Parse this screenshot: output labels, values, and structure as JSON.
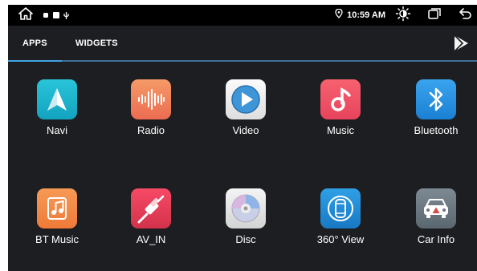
{
  "status_bar": {
    "time": "10:59 AM",
    "icons": [
      "home-icon",
      "status-indicator-icons",
      "location-icon",
      "brightness-icon",
      "recent-apps-icon",
      "back-icon"
    ]
  },
  "tabs": [
    {
      "label": "APPS",
      "active": true
    },
    {
      "label": "WIDGETS",
      "active": false
    }
  ],
  "apps": [
    {
      "label": "Navi",
      "icon": "navigation-arrow-icon",
      "color": "#1aafc9"
    },
    {
      "label": "Radio",
      "icon": "radio-waveform-icon",
      "color": "#f07f5b"
    },
    {
      "label": "Video",
      "icon": "video-play-icon",
      "color": "#3e95d8"
    },
    {
      "label": "Music",
      "icon": "music-note-icon",
      "color": "#ee4e62"
    },
    {
      "label": "Bluetooth",
      "icon": "bluetooth-icon",
      "color": "#2790df"
    },
    {
      "label": "BT Music",
      "icon": "bt-music-icon",
      "color": "#f28a45"
    },
    {
      "label": "AV_IN",
      "icon": "av-in-cable-icon",
      "color": "#e83d58"
    },
    {
      "label": "Disc",
      "icon": "disc-icon",
      "color": "#dcdcdc"
    },
    {
      "label": "360° View",
      "icon": "car-360-view-icon",
      "color": "#2188d3"
    },
    {
      "label": "Car Info",
      "icon": "car-info-icon",
      "color": "#6a757e"
    }
  ],
  "colors": {
    "background": "#1d1e21",
    "status_bar": "#000000",
    "tab_accent": "#3ea4e3"
  }
}
